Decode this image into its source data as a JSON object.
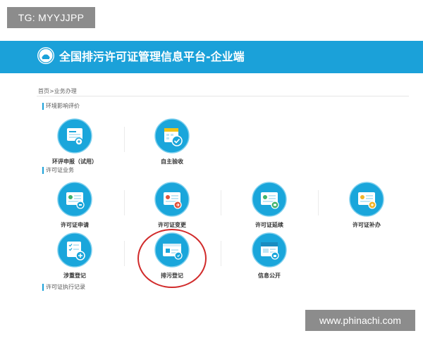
{
  "watermark_top": "TG: MYYJJPP",
  "watermark_bottom": "www.phinachi.com",
  "header": {
    "title": "全国排污许可证管理信息平台-企业端"
  },
  "breadcrumb": "首页>业务办理",
  "sections": {
    "env": {
      "title": "环境影响评价"
    },
    "permit": {
      "title": "许可证业务"
    },
    "exec": {
      "title": "许可证执行记录"
    }
  },
  "tiles": {
    "eia_report": {
      "label": "环评申报（试用）",
      "icon": "document-icon"
    },
    "self_accept": {
      "label": "自主验收",
      "icon": "calendar-check-icon"
    },
    "permit_apply": {
      "label": "许可证申请",
      "icon": "permit-apply-icon"
    },
    "permit_change": {
      "label": "许可证变更",
      "icon": "permit-change-icon"
    },
    "permit_renew": {
      "label": "许可证延续",
      "icon": "permit-renew-icon"
    },
    "permit_reissue": {
      "label": "许可证补办",
      "icon": "permit-reissue-icon"
    },
    "key_register": {
      "label": "涉重登记",
      "icon": "checklist-add-icon"
    },
    "discharge_register": {
      "label": "排污登记",
      "icon": "id-card-icon"
    },
    "info_public": {
      "label": "信息公开",
      "icon": "news-icon"
    }
  },
  "colors": {
    "brand": "#1ba1d9",
    "icon_circle": "#1aa6db",
    "highlight": "#d12b2b"
  }
}
